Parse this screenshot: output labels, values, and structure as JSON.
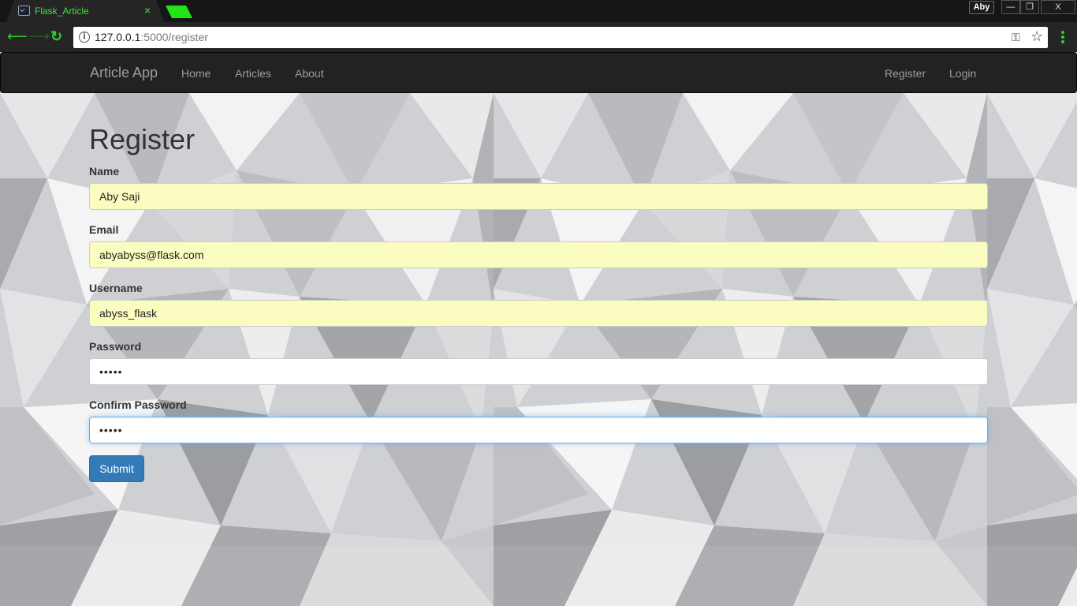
{
  "browser": {
    "tab_title": "Flask_Article",
    "tab_close": "×",
    "profile_name": "Aby",
    "window_controls": {
      "minimize": "—",
      "restore": "❐",
      "close": "X"
    },
    "address": {
      "host": "127.0.0.1",
      "rest": ":5000/register"
    },
    "icons": {
      "back": "arrow-left",
      "forward": "arrow-right",
      "reload": "reload",
      "info": "info",
      "key": "key",
      "star": "star",
      "menu": "kebab-menu"
    },
    "accent_color": "#2fd02c"
  },
  "navbar": {
    "brand": "Article App",
    "links": [
      "Home",
      "Articles",
      "About"
    ],
    "right_links": [
      "Register",
      "Login"
    ]
  },
  "form": {
    "title": "Register",
    "fields": [
      {
        "label": "Name",
        "value": "Aby Saji",
        "type": "text"
      },
      {
        "label": "Email",
        "value": "abyabyss@flask.com",
        "type": "text"
      },
      {
        "label": "Username",
        "value": "abyss_flask",
        "type": "text"
      },
      {
        "label": "Password",
        "value": "•••••",
        "type": "password"
      },
      {
        "label": "Confirm Password",
        "value": "•••••",
        "type": "password"
      }
    ],
    "submit_label": "Submit"
  }
}
